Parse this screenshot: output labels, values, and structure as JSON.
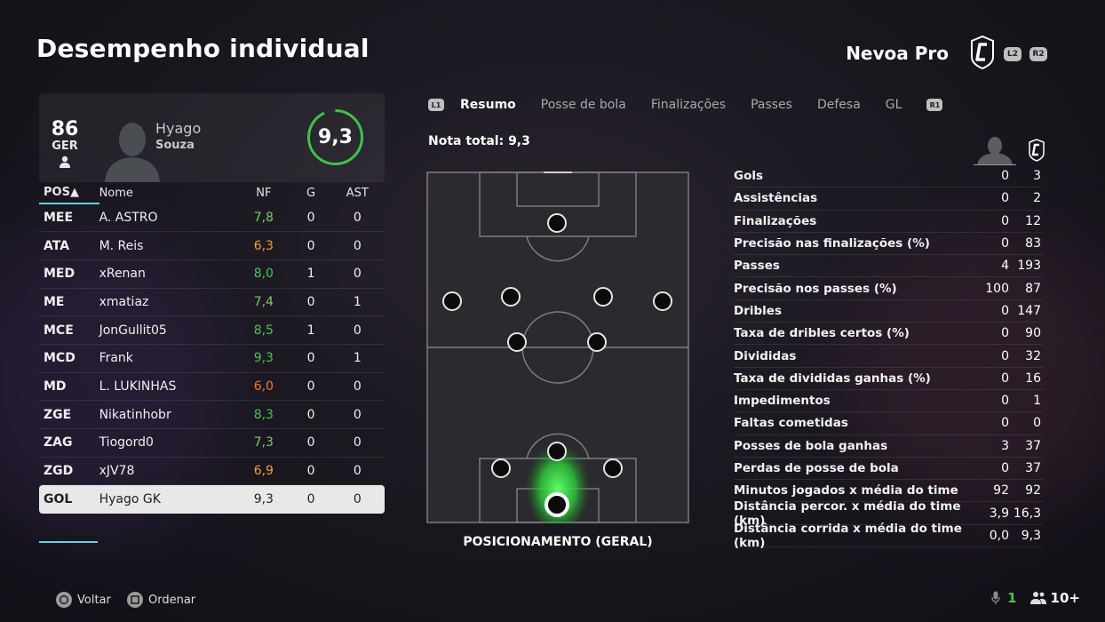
{
  "header": {
    "title": "Desempenho individual",
    "club_name": "Nevoa Pro",
    "l2_label": "L2",
    "r2_label": "R2"
  },
  "player": {
    "overall": "86",
    "position": "GER",
    "first_name": "Hyago",
    "last_name": "Souza",
    "rating": "9,3",
    "rating_fraction": 0.93
  },
  "table": {
    "headers": {
      "pos": "POS▲",
      "name": "Nome",
      "nf": "NF",
      "g": "G",
      "ast": "AST"
    },
    "rows": [
      {
        "pos": "MEE",
        "name": "A. ASTRO",
        "nf": "7,8",
        "nf_color": "#7ec86a",
        "g": "0",
        "ast": "0"
      },
      {
        "pos": "ATA",
        "name": "M. Reis",
        "nf": "6,3",
        "nf_color": "#f0a23a",
        "g": "0",
        "ast": "0"
      },
      {
        "pos": "MED",
        "name": "xRenan",
        "nf": "8,0",
        "nf_color": "#46c54c",
        "g": "1",
        "ast": "0"
      },
      {
        "pos": "ME",
        "name": "xmatiaz",
        "nf": "7,4",
        "nf_color": "#7ec86a",
        "g": "0",
        "ast": "1"
      },
      {
        "pos": "MCE",
        "name": "JonGullit05",
        "nf": "8,5",
        "nf_color": "#46c54c",
        "g": "1",
        "ast": "0"
      },
      {
        "pos": "MCD",
        "name": "Frank",
        "nf": "9,3",
        "nf_color": "#46c54c",
        "g": "0",
        "ast": "1"
      },
      {
        "pos": "MD",
        "name": "L. LUKINHAS",
        "nf": "6,0",
        "nf_color": "#f07a2a",
        "g": "0",
        "ast": "0"
      },
      {
        "pos": "ZGE",
        "name": "Nikatinhobr",
        "nf": "8,3",
        "nf_color": "#46c54c",
        "g": "0",
        "ast": "0"
      },
      {
        "pos": "ZAG",
        "name": "Tiogord0",
        "nf": "7,3",
        "nf_color": "#7ec86a",
        "g": "0",
        "ast": "0"
      },
      {
        "pos": "ZGD",
        "name": "xJV78",
        "nf": "6,9",
        "nf_color": "#f0a23a",
        "g": "0",
        "ast": "0"
      },
      {
        "pos": "GOL",
        "name": "Hyago GK",
        "nf": "9,3",
        "nf_color": "#222222",
        "g": "0",
        "ast": "0"
      }
    ]
  },
  "tabs": {
    "l1_label": "L1",
    "r1_label": "R1",
    "items": [
      "Resumo",
      "Posse de bola",
      "Finalizações",
      "Passes",
      "Defesa",
      "GL"
    ]
  },
  "summary": {
    "total_label": "Nota total: 9,3",
    "pitch_caption": "POSICIONAMENTO (GERAL)"
  },
  "stats": [
    {
      "label": "Gols",
      "player": "0",
      "team": "3"
    },
    {
      "label": "Assistências",
      "player": "0",
      "team": "2"
    },
    {
      "label": "Finalizações",
      "player": "0",
      "team": "12"
    },
    {
      "label": "Precisão nas finalizações (%)",
      "player": "0",
      "team": "83"
    },
    {
      "label": "Passes",
      "player": "4",
      "team": "193"
    },
    {
      "label": "Precisão nos passes (%)",
      "player": "100",
      "team": "87"
    },
    {
      "label": "Dribles",
      "player": "0",
      "team": "147"
    },
    {
      "label": "Taxa de dribles certos (%)",
      "player": "0",
      "team": "90"
    },
    {
      "label": "Divididas",
      "player": "0",
      "team": "32"
    },
    {
      "label": "Taxa de divididas ganhas (%)",
      "player": "0",
      "team": "16"
    },
    {
      "label": "Impedimentos",
      "player": "0",
      "team": "1"
    },
    {
      "label": "Faltas cometidas",
      "player": "0",
      "team": "0"
    },
    {
      "label": "Posses de bola ganhas",
      "player": "3",
      "team": "37"
    },
    {
      "label": "Perdas de posse de bola",
      "player": "0",
      "team": "37"
    },
    {
      "label": "Minutos jogados x média do time",
      "player": "92",
      "team": "92"
    },
    {
      "label": "Distância percor. x média do time (km)",
      "player": "3,9",
      "team": "16,3"
    },
    {
      "label": "Distância corrida x média do time (km)",
      "player": "0,0",
      "team": "9,3"
    }
  ],
  "footer": {
    "back_label": "Voltar",
    "sort_label": "Ordenar",
    "mic_count": "1",
    "party_count": "10+"
  },
  "colors": {
    "accent": "#5fd3e3",
    "rating_ring": "#3ec24a"
  }
}
